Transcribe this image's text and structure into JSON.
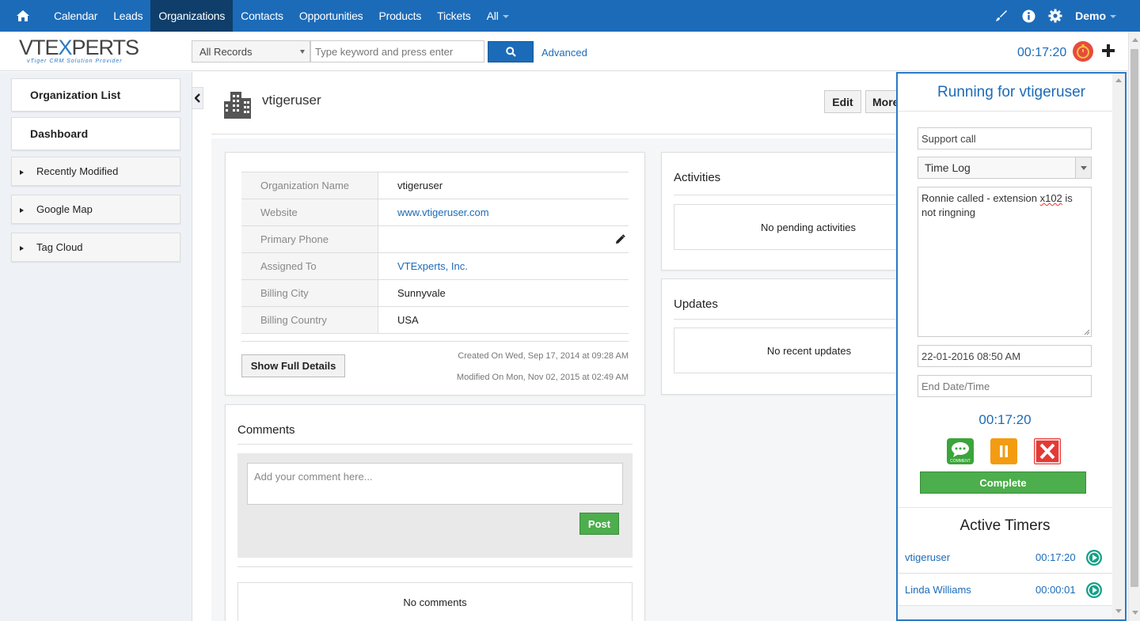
{
  "colors": {
    "nav_bg": "#1c6bb8",
    "nav_active": "#0f3e6b",
    "accent": "#1c6bb8",
    "success": "#4cae4c",
    "timer_border": "#2a79c4"
  },
  "nav": {
    "home_icon": "home-icon",
    "items": [
      {
        "label": "Calendar",
        "active": false
      },
      {
        "label": "Leads",
        "active": false
      },
      {
        "label": "Organizations",
        "active": true
      },
      {
        "label": "Contacts",
        "active": false
      },
      {
        "label": "Opportunities",
        "active": false
      },
      {
        "label": "Products",
        "active": false
      },
      {
        "label": "Tickets",
        "active": false
      }
    ],
    "all_label": "All",
    "right_icons": [
      "brush-icon",
      "info-icon",
      "gear-icon"
    ],
    "user": "Demo"
  },
  "header": {
    "logo_main_1": "VTE",
    "logo_main_x": "X",
    "logo_main_2": "PERTS",
    "logo_tagline": "vTiger CRM Solution Provider",
    "records_select": "All Records",
    "search_placeholder": "Type keyword and press enter",
    "advanced_label": "Advanced",
    "timer": "00:17:20"
  },
  "sidebar": {
    "primary": [
      "Organization List",
      "Dashboard"
    ],
    "widgets": [
      "Recently Modified",
      "Google Map",
      "Tag Cloud"
    ]
  },
  "record": {
    "name": "vtigeruser",
    "edit_label": "Edit",
    "more_label": "More",
    "fields": [
      {
        "label": "Organization Name",
        "value": "vtigeruser",
        "link": false
      },
      {
        "label": "Website",
        "value": "www.vtigeruser.com",
        "link": true
      },
      {
        "label": "Primary Phone",
        "value": "",
        "link": false
      },
      {
        "label": "Assigned To",
        "value": "VTExperts, Inc.",
        "link": true
      },
      {
        "label": "Billing City",
        "value": "Sunnyvale",
        "link": false
      },
      {
        "label": "Billing Country",
        "value": "USA",
        "link": false
      }
    ],
    "show_full_label": "Show Full Details",
    "created": "Created On Wed, Sep 17, 2014 at 09:28 AM",
    "modified": "Modified On Mon, Nov 02, 2015 at 02:49 AM"
  },
  "comments": {
    "title": "Comments",
    "placeholder": "Add your comment here...",
    "post_label": "Post",
    "empty": "No comments"
  },
  "activities": {
    "title": "Activities",
    "empty": "No pending activities"
  },
  "updates": {
    "title": "Updates",
    "empty": "No recent updates"
  },
  "timer_panel": {
    "title": "Running for vtigeruser",
    "subject": "Support call",
    "type": "Time Log",
    "desc_1": "Ronnie called - extension ",
    "desc_spell": "x102",
    "desc_2": " is not ringning",
    "start": "22-01-2016 08:50 AM",
    "end_placeholder": "End Date/Time",
    "elapsed": "00:17:20",
    "comment_icon_text": "COMMENT",
    "complete_label": "Complete",
    "active_title": "Active Timers",
    "active": [
      {
        "name": "vtigeruser",
        "time": "00:17:20"
      },
      {
        "name": "Linda Williams",
        "time": "00:00:01"
      }
    ]
  }
}
